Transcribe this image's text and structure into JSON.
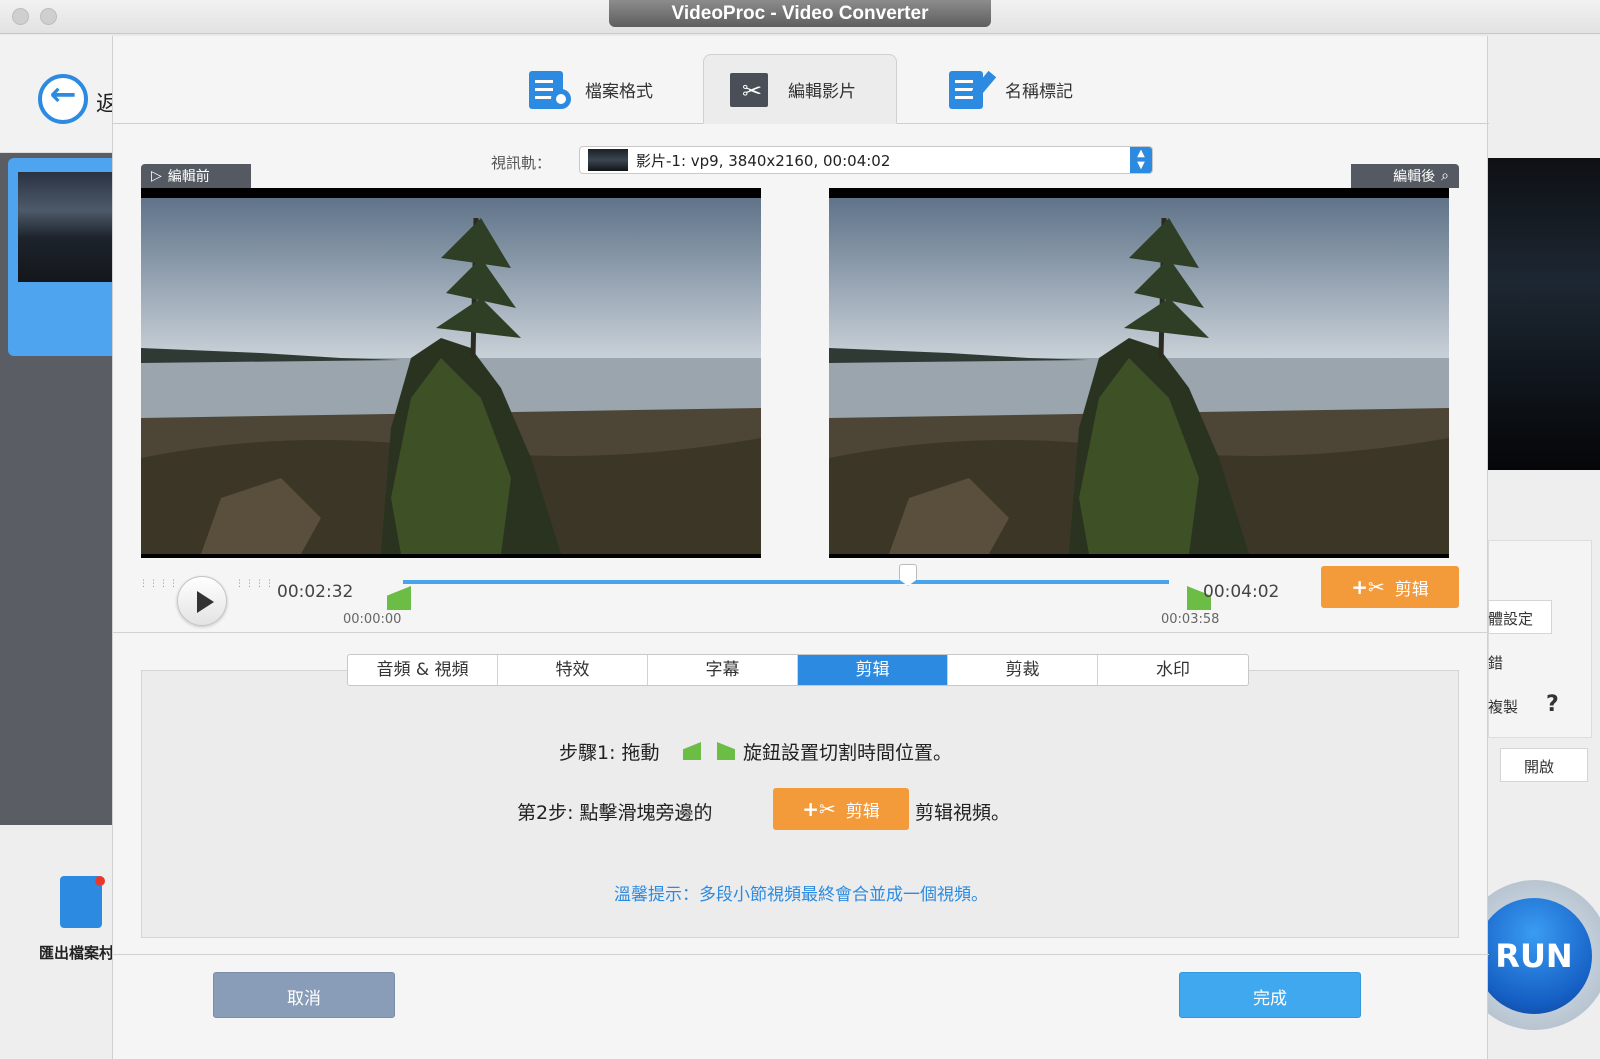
{
  "window": {
    "title": "VideoProc - Video Converter"
  },
  "background": {
    "back_label": "返",
    "export_label": "匯出檔案村",
    "right_labels": [
      "體設定",
      "錯",
      "複製",
      "?",
      "開啟"
    ],
    "run_label": "RUN"
  },
  "top_tabs": [
    {
      "label": "檔案格式",
      "icon": "format-doc-gear-icon"
    },
    {
      "label": "編輯影片",
      "icon": "film-scissors-icon"
    },
    {
      "label": "名稱標記",
      "icon": "doc-pen-icon"
    }
  ],
  "track": {
    "label": "視訊軌：",
    "value": "影片-1: vp9, 3840x2160, 00:04:02"
  },
  "preview": {
    "before_label": "編輯前",
    "after_label": "編輯後"
  },
  "player": {
    "current_time": "00:02:32",
    "total_time": "00:04:02",
    "start_marker": "00:00:00",
    "end_marker": "00:03:58",
    "cut_label": "剪辑",
    "cut_icon": "+✂"
  },
  "edit_tabs": [
    {
      "label": "音頻 & 視頻",
      "active": false
    },
    {
      "label": "特效",
      "active": false
    },
    {
      "label": "字幕",
      "active": false
    },
    {
      "label": "剪辑",
      "active": true
    },
    {
      "label": "剪裁",
      "active": false
    },
    {
      "label": "水印",
      "active": false
    }
  ],
  "instructions": {
    "step1_prefix": "步驟1: 拖動",
    "step1_suffix": "旋鈕設置切割時間位置。",
    "step2_prefix": "第2步: 點擊滑塊旁邊的",
    "step2_suffix": "剪辑視頻。",
    "tip": "溫馨提示：多段小節視頻最終會合並成一個視頻。"
  },
  "buttons": {
    "cancel": "取消",
    "done": "完成"
  },
  "colors": {
    "accent_blue": "#2c8be0",
    "cut_orange": "#f39a3a",
    "handle_green": "#6cbd45",
    "cancel_gray_blue": "#8a9db8",
    "done_blue": "#40a8ef"
  }
}
